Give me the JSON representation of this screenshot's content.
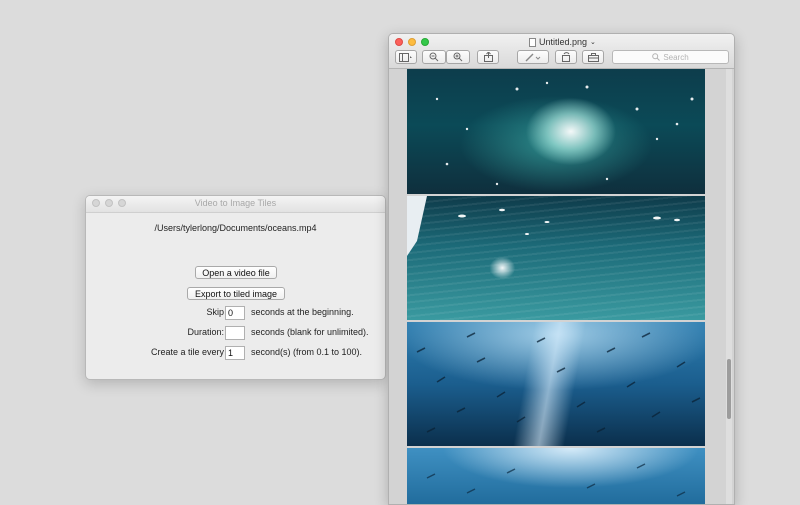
{
  "left_window": {
    "title": "Video to Image Tiles",
    "file_path": "/Users/tylerlong/Documents/oceans.mp4",
    "open_button": "Open a video file",
    "export_button": "Export to tiled image",
    "skip": {
      "label": "Skip",
      "value": "0",
      "suffix": "seconds at the beginning."
    },
    "duration": {
      "label": "Duration:",
      "value": "",
      "suffix": "seconds (blank for unlimited)."
    },
    "tile_every": {
      "label": "Create a tile every",
      "value": "1",
      "suffix": "second(s) (from 0.1 to 100)."
    }
  },
  "preview_window": {
    "title": "Untitled.png",
    "search_placeholder": "Search",
    "toolbar_icons": [
      "sidebar-icon",
      "zoom-out-icon",
      "zoom-in-icon",
      "share-icon",
      "markup-pen-icon",
      "rotate-icon",
      "toolbox-icon"
    ],
    "image_tiles": [
      "ocean-splash-tile",
      "ocean-surface-tile",
      "fish-school-tile",
      "fish-school-tile-partial"
    ]
  },
  "colors": {
    "desktop": "#dcdcdc",
    "close": "#fc605b",
    "minimize": "#fdbc40",
    "zoom": "#34c84a"
  }
}
